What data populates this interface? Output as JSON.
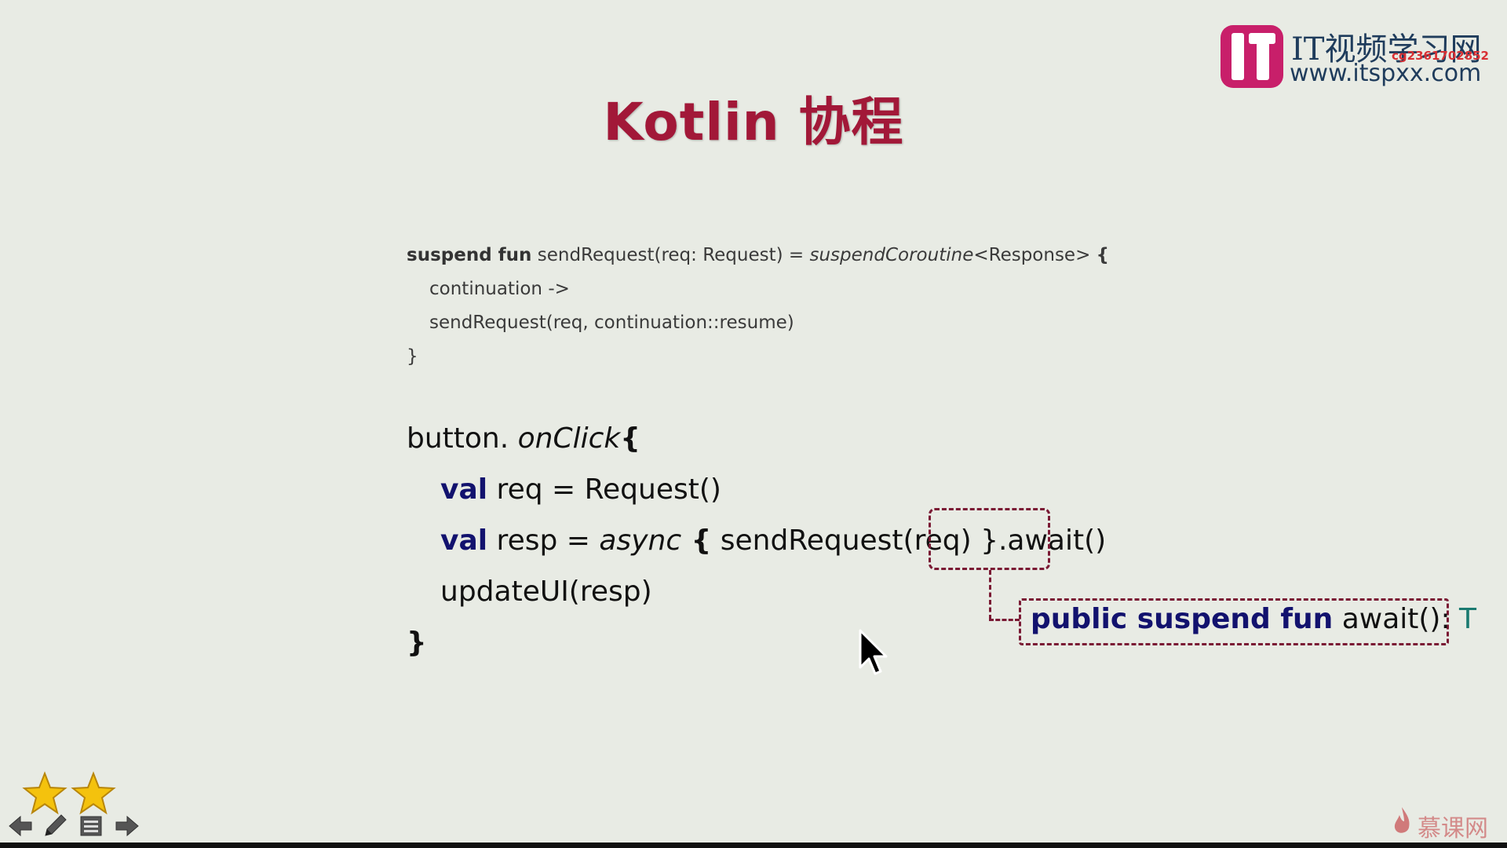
{
  "slide": {
    "title": "Kotlin 协程"
  },
  "logo": {
    "cn_text": "IT视频学习网",
    "url": "www.itspxx.com",
    "watermark": "cg2361702852"
  },
  "code_small": {
    "l1_kw": "suspend fun",
    "l1_a": " sendRequest(req: Request) = ",
    "l1_it": "suspendCoroutine",
    "l1_b": "<Response> ",
    "l1_brace": "{",
    "l2": "continuation ->",
    "l3": "sendRequest(req, continuation::resume)",
    "l4": "}"
  },
  "code_large": {
    "l1_a": "button. ",
    "l1_it": "onClick",
    "l1_brace": "{",
    "l2_kw": "val",
    "l2_rest": " req = Request()",
    "l3_kw": "val",
    "l3_a": " resp = ",
    "l3_it": "async",
    "l3_brace": " {",
    "l3_b": " sendRequest(req) ",
    "l3_c": "}.await()",
    "l4": "updateUI(resp)",
    "l5": "}"
  },
  "annotation": {
    "kw": "public suspend fun",
    "rest": " await(): ",
    "type": "T"
  },
  "brand": {
    "text": "慕课网"
  },
  "colors": {
    "title": "#a21838",
    "keyword": "#12126e",
    "annotation_border": "#7a1a34",
    "type_param": "#1a7a70",
    "background": "#e8ebe4"
  },
  "icons": [
    "star-icon",
    "prev-arrow-icon",
    "pen-icon",
    "menu-icon",
    "next-arrow-icon",
    "mouse-cursor-icon",
    "flame-icon"
  ]
}
